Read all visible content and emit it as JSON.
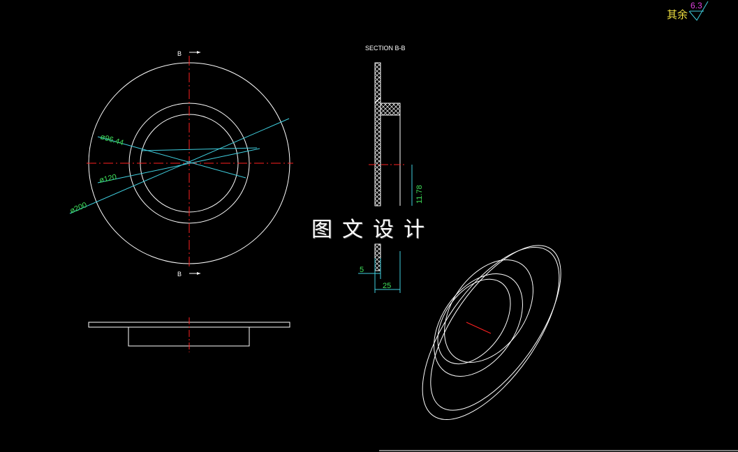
{
  "drawing": {
    "surface_label": "其余",
    "roughness_value": "6.3",
    "section_title": "SECTION B-B",
    "section_marks": [
      "B",
      "B"
    ],
    "dimensions": {
      "inner_diameter": "ø96.44",
      "middle_diameter": "ø120",
      "outer_diameter": "ø200",
      "height": "11.78",
      "thickness": "5",
      "width": "25"
    },
    "watermark_text": "图文设计",
    "colors": {
      "background": "#000000",
      "geometry": "#ffffff",
      "centerline": "#ff2020",
      "dimension_line": "#40d0e0",
      "dimension_text": "#3fe05a",
      "note_text": "#f0e040",
      "roughness_text": "#e040e0"
    }
  }
}
